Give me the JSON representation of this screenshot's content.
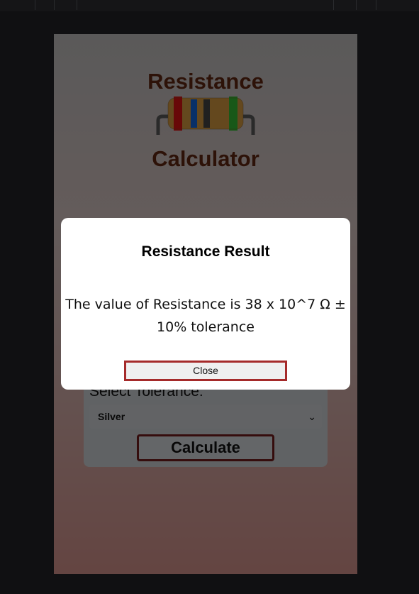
{
  "app": {
    "title_line1": "Resistance",
    "title_line2": "Calculator"
  },
  "form": {
    "tolerance_label": "Select Tolerance:",
    "tolerance_selected": "Silver",
    "calculate_label": "Calculate"
  },
  "modal": {
    "title": "Resistance Result",
    "message": "The value of Resistance is 38 x 10^7 Ω ± 10% tolerance",
    "close_label": "Close"
  },
  "colors": {
    "title": "#5a2410",
    "button_border": "#a52a2a",
    "resistor_body": "#c8903c",
    "band1": "#d01010",
    "band2": "#1060d0",
    "band3": "#404040",
    "band4": "#30b030"
  },
  "icons": [
    "resistor-icon",
    "chevron-down-icon"
  ]
}
